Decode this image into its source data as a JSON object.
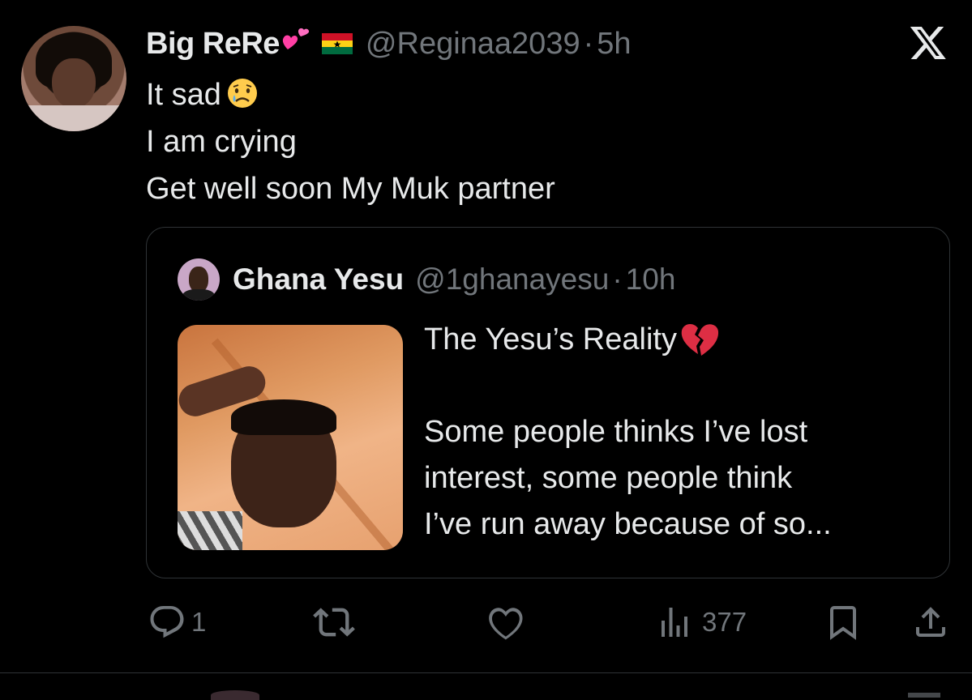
{
  "tweet": {
    "author_name": "Big ReRe",
    "name_emoji": "💕",
    "flag": "ghana-flag",
    "handle": "@Reginaa2039",
    "separator": "·",
    "time": "5h",
    "lines": [
      "It sad",
      "I am crying",
      "Get well soon My Muk partner"
    ],
    "line1_emoji": "😢"
  },
  "quoted": {
    "author_name": "Ghana Yesu",
    "handle": "@1ghanayesu",
    "separator": "·",
    "time": "10h",
    "title": "The Yesu’s Reality",
    "title_emoji": "💔",
    "body_lines": [
      "Some people thinks I’ve lost",
      "interest, some people think",
      "I’ve run away because of so..."
    ]
  },
  "actions": {
    "replies": "1",
    "reposts": "",
    "likes": "",
    "views": "377"
  },
  "icons": {
    "logo": "x-logo-icon",
    "reply": "reply-icon",
    "repost": "repost-icon",
    "like": "heart-icon",
    "views": "views-icon",
    "bookmark": "bookmark-icon",
    "share": "share-icon"
  },
  "colors": {
    "background": "#000000",
    "text": "#e7e9ea",
    "muted": "#71767b",
    "border": "#2f3336"
  }
}
